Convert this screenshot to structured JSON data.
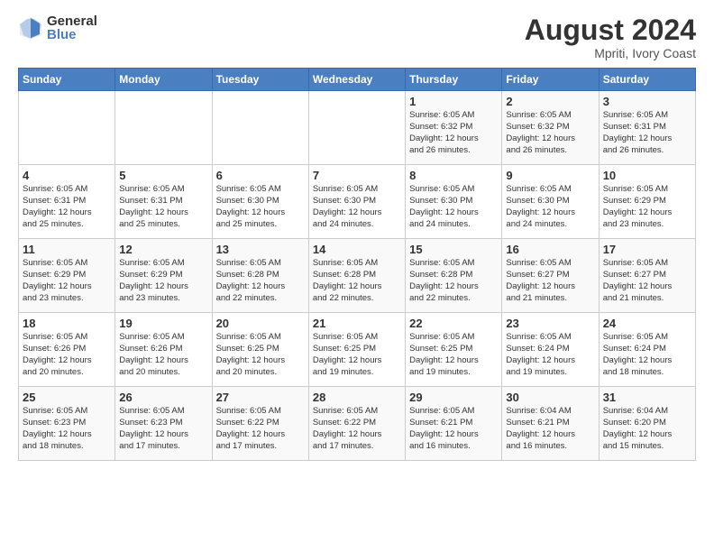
{
  "header": {
    "logo_general": "General",
    "logo_blue": "Blue",
    "month_year": "August 2024",
    "location": "Mpriti, Ivory Coast"
  },
  "weekdays": [
    "Sunday",
    "Monday",
    "Tuesday",
    "Wednesday",
    "Thursday",
    "Friday",
    "Saturday"
  ],
  "weeks": [
    [
      {
        "day": "",
        "info": ""
      },
      {
        "day": "",
        "info": ""
      },
      {
        "day": "",
        "info": ""
      },
      {
        "day": "",
        "info": ""
      },
      {
        "day": "1",
        "info": "Sunrise: 6:05 AM\nSunset: 6:32 PM\nDaylight: 12 hours\nand 26 minutes."
      },
      {
        "day": "2",
        "info": "Sunrise: 6:05 AM\nSunset: 6:32 PM\nDaylight: 12 hours\nand 26 minutes."
      },
      {
        "day": "3",
        "info": "Sunrise: 6:05 AM\nSunset: 6:31 PM\nDaylight: 12 hours\nand 26 minutes."
      }
    ],
    [
      {
        "day": "4",
        "info": "Sunrise: 6:05 AM\nSunset: 6:31 PM\nDaylight: 12 hours\nand 25 minutes."
      },
      {
        "day": "5",
        "info": "Sunrise: 6:05 AM\nSunset: 6:31 PM\nDaylight: 12 hours\nand 25 minutes."
      },
      {
        "day": "6",
        "info": "Sunrise: 6:05 AM\nSunset: 6:30 PM\nDaylight: 12 hours\nand 25 minutes."
      },
      {
        "day": "7",
        "info": "Sunrise: 6:05 AM\nSunset: 6:30 PM\nDaylight: 12 hours\nand 24 minutes."
      },
      {
        "day": "8",
        "info": "Sunrise: 6:05 AM\nSunset: 6:30 PM\nDaylight: 12 hours\nand 24 minutes."
      },
      {
        "day": "9",
        "info": "Sunrise: 6:05 AM\nSunset: 6:30 PM\nDaylight: 12 hours\nand 24 minutes."
      },
      {
        "day": "10",
        "info": "Sunrise: 6:05 AM\nSunset: 6:29 PM\nDaylight: 12 hours\nand 23 minutes."
      }
    ],
    [
      {
        "day": "11",
        "info": "Sunrise: 6:05 AM\nSunset: 6:29 PM\nDaylight: 12 hours\nand 23 minutes."
      },
      {
        "day": "12",
        "info": "Sunrise: 6:05 AM\nSunset: 6:29 PM\nDaylight: 12 hours\nand 23 minutes."
      },
      {
        "day": "13",
        "info": "Sunrise: 6:05 AM\nSunset: 6:28 PM\nDaylight: 12 hours\nand 22 minutes."
      },
      {
        "day": "14",
        "info": "Sunrise: 6:05 AM\nSunset: 6:28 PM\nDaylight: 12 hours\nand 22 minutes."
      },
      {
        "day": "15",
        "info": "Sunrise: 6:05 AM\nSunset: 6:28 PM\nDaylight: 12 hours\nand 22 minutes."
      },
      {
        "day": "16",
        "info": "Sunrise: 6:05 AM\nSunset: 6:27 PM\nDaylight: 12 hours\nand 21 minutes."
      },
      {
        "day": "17",
        "info": "Sunrise: 6:05 AM\nSunset: 6:27 PM\nDaylight: 12 hours\nand 21 minutes."
      }
    ],
    [
      {
        "day": "18",
        "info": "Sunrise: 6:05 AM\nSunset: 6:26 PM\nDaylight: 12 hours\nand 20 minutes."
      },
      {
        "day": "19",
        "info": "Sunrise: 6:05 AM\nSunset: 6:26 PM\nDaylight: 12 hours\nand 20 minutes."
      },
      {
        "day": "20",
        "info": "Sunrise: 6:05 AM\nSunset: 6:25 PM\nDaylight: 12 hours\nand 20 minutes."
      },
      {
        "day": "21",
        "info": "Sunrise: 6:05 AM\nSunset: 6:25 PM\nDaylight: 12 hours\nand 19 minutes."
      },
      {
        "day": "22",
        "info": "Sunrise: 6:05 AM\nSunset: 6:25 PM\nDaylight: 12 hours\nand 19 minutes."
      },
      {
        "day": "23",
        "info": "Sunrise: 6:05 AM\nSunset: 6:24 PM\nDaylight: 12 hours\nand 19 minutes."
      },
      {
        "day": "24",
        "info": "Sunrise: 6:05 AM\nSunset: 6:24 PM\nDaylight: 12 hours\nand 18 minutes."
      }
    ],
    [
      {
        "day": "25",
        "info": "Sunrise: 6:05 AM\nSunset: 6:23 PM\nDaylight: 12 hours\nand 18 minutes."
      },
      {
        "day": "26",
        "info": "Sunrise: 6:05 AM\nSunset: 6:23 PM\nDaylight: 12 hours\nand 17 minutes."
      },
      {
        "day": "27",
        "info": "Sunrise: 6:05 AM\nSunset: 6:22 PM\nDaylight: 12 hours\nand 17 minutes."
      },
      {
        "day": "28",
        "info": "Sunrise: 6:05 AM\nSunset: 6:22 PM\nDaylight: 12 hours\nand 17 minutes."
      },
      {
        "day": "29",
        "info": "Sunrise: 6:05 AM\nSunset: 6:21 PM\nDaylight: 12 hours\nand 16 minutes."
      },
      {
        "day": "30",
        "info": "Sunrise: 6:04 AM\nSunset: 6:21 PM\nDaylight: 12 hours\nand 16 minutes."
      },
      {
        "day": "31",
        "info": "Sunrise: 6:04 AM\nSunset: 6:20 PM\nDaylight: 12 hours\nand 15 minutes."
      }
    ]
  ]
}
